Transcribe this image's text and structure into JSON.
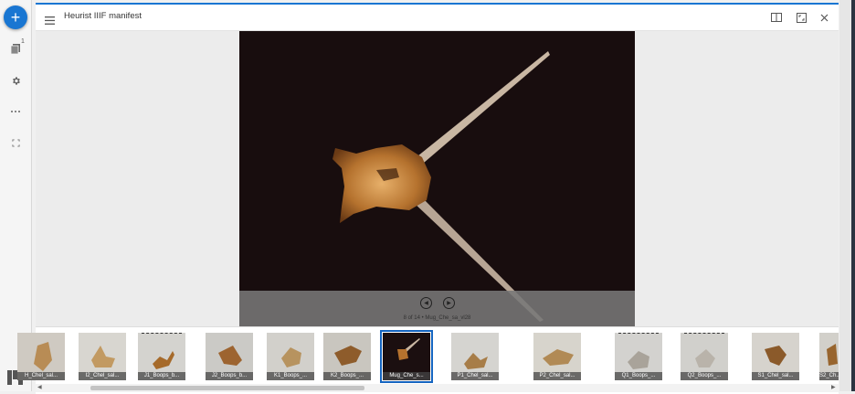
{
  "window": {
    "title": "Heurist IIIF manifest"
  },
  "rail": {
    "add_label": "+",
    "badge_count": "1"
  },
  "viewer": {
    "caption": "8 of 14 • Mug_Che_sa_vl28",
    "current_index": 8,
    "total": 14
  },
  "thumbnails": [
    {
      "label": "H_Chel_sal..."
    },
    {
      "label": "I2_Chel_sal..."
    },
    {
      "label": "J1_Boops_b..."
    },
    {
      "label": "J2_Boops_b..."
    },
    {
      "label": "K1_Boops_..."
    },
    {
      "label": "K2_Boops_..."
    },
    {
      "label": "Mug_Che_s..."
    },
    {
      "label": "P1_Chel_sal..."
    },
    {
      "label": "P2_Chel_sal..."
    },
    {
      "label": "Q1_Boops_..."
    },
    {
      "label": "Q2_Boops_..."
    },
    {
      "label": "S1_Chel_sal..."
    },
    {
      "label": "S2_Ch..."
    }
  ],
  "colors": {
    "accent": "#1976d2",
    "image_background": "#180d0e"
  }
}
